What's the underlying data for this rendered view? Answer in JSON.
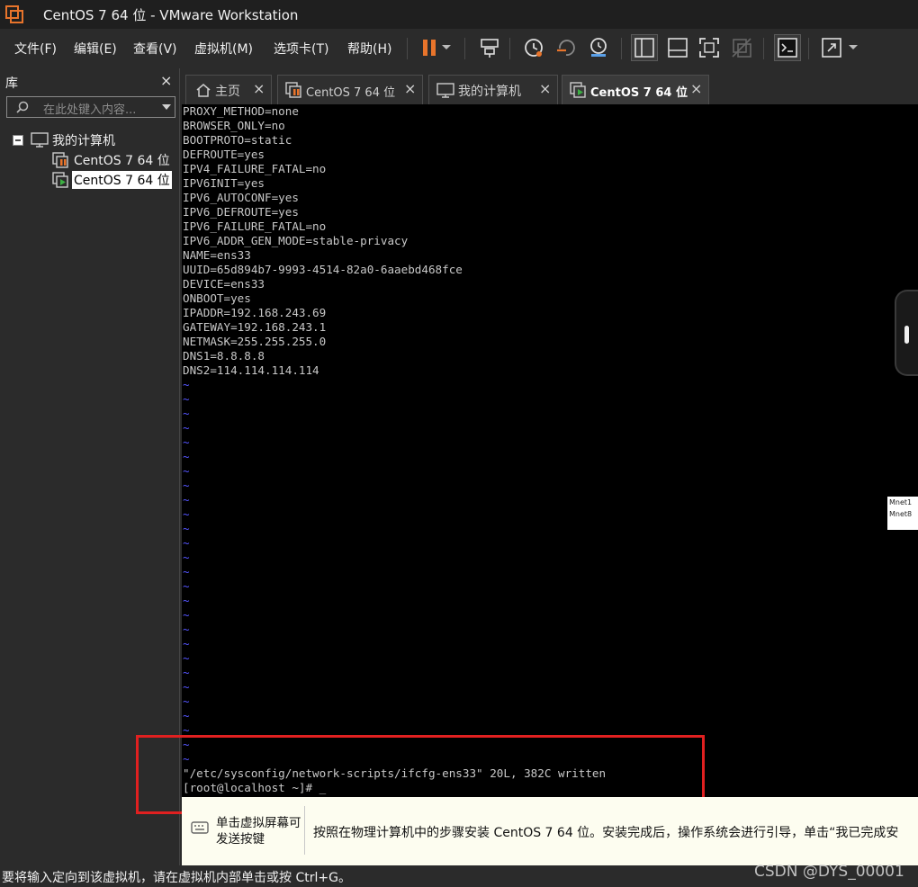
{
  "window": {
    "title": "CentOS 7 64 位 - VMware Workstation"
  },
  "menu": {
    "items": [
      "文件(F)",
      "编辑(E)",
      "查看(V)",
      "虚拟机(M)",
      "选项卡(T)",
      "帮助(H)"
    ]
  },
  "toolbar": {
    "buttons": [
      "pause-icon",
      "dropdown-icon",
      "send-ctrl-alt-del-icon",
      "snapshot-icon",
      "revert-snapshot-icon",
      "snapshot-manager-icon",
      "show-library-icon",
      "thumbnail-bar-icon",
      "fullscreen-icon",
      "unity-icon",
      "console-view-icon",
      "stretch-icon",
      "dropdown-icon"
    ]
  },
  "library": {
    "title": "库",
    "close": "×",
    "search_placeholder": "在此处键入内容...",
    "tree": {
      "root": "我的计算机",
      "children": [
        "CentOS 7 64 位",
        "CentOS 7 64 位"
      ]
    }
  },
  "tabs": [
    {
      "label": "主页",
      "icon": "home-icon",
      "close": "×"
    },
    {
      "label": "CentOS 7 64 位",
      "icon": "vm-paused-icon",
      "close": "×"
    },
    {
      "label": "我的计算机",
      "icon": "computer-icon",
      "close": "×"
    },
    {
      "label": "CentOS 7 64 位",
      "icon": "vm-running-icon",
      "close": "×"
    }
  ],
  "terminal": {
    "lines": [
      "PROXY_METHOD=none",
      "BROWSER_ONLY=no",
      "BOOTPROTO=static",
      "DEFROUTE=yes",
      "IPV4_FAILURE_FATAL=no",
      "IPV6INIT=yes",
      "IPV6_AUTOCONF=yes",
      "IPV6_DEFROUTE=yes",
      "IPV6_FAILURE_FATAL=no",
      "IPV6_ADDR_GEN_MODE=stable-privacy",
      "NAME=ens33",
      "UUID=65d894b7-9993-4514-82a0-6aaebd468fce",
      "DEVICE=ens33",
      "ONBOOT=yes",
      "IPADDR=192.168.243.69",
      "GATEWAY=192.168.243.1",
      "NETMASK=255.255.255.0",
      "DNS1=8.8.8.8",
      "DNS2=114.114.114.114"
    ],
    "tilde": "~",
    "status_line": "\"/etc/sysconfig/network-scripts/ifcfg-ens33\" 20L, 382C written",
    "prompt": "[root@localhost ~]# _"
  },
  "popup": {
    "lines": [
      "Mnet1",
      "Mnet8"
    ]
  },
  "notice": {
    "hint": "单击虚拟屏幕可发送按键",
    "message": "按照在物理计算机中的步骤安装 CentOS 7 64 位。安装完成后，操作系统会进行引导，单击“我已完成安"
  },
  "statusbar": {
    "text": "要将输入定向到该虚拟机，请在虚拟机内部单击或按 Ctrl+G。",
    "watermark": "CSDN @DYS_00001"
  },
  "colors": {
    "accent": "#e8742b",
    "highlight": "#e02020",
    "tilde": "#5555ff"
  }
}
